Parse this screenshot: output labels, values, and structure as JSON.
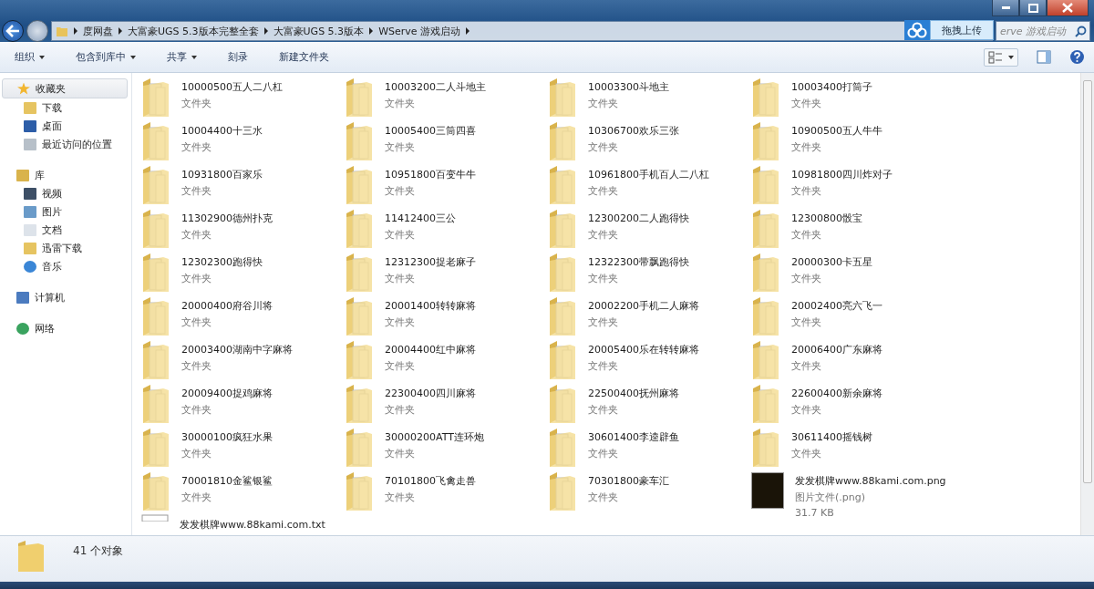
{
  "address_bar": {
    "crumbs": [
      "度网盘",
      "大富豪UGS 5.3版本完整全套",
      "大富豪UGS 5.3版本",
      "WServe 游戏启动"
    ]
  },
  "search": {
    "placeholder": "erve 游戏启动"
  },
  "upload_overlay": {
    "label": "拖拽上传"
  },
  "toolbar": [
    {
      "label": "组织",
      "menu": true
    },
    {
      "label": "包含到库中",
      "menu": true
    },
    {
      "label": "共享",
      "menu": true
    },
    {
      "label": "刻录",
      "menu": false
    },
    {
      "label": "新建文件夹",
      "menu": false
    }
  ],
  "sidebar": [
    {
      "label": "收藏夹",
      "kind": "favorites",
      "selected": true,
      "children": [
        {
          "label": "下载",
          "kind": "download"
        },
        {
          "label": "桌面",
          "kind": "desktop"
        },
        {
          "label": "最近访问的位置",
          "kind": "recent"
        }
      ]
    },
    {
      "label": "库",
      "kind": "library",
      "selected": false,
      "children": [
        {
          "label": "视频",
          "kind": "video"
        },
        {
          "label": "图片",
          "kind": "picture"
        },
        {
          "label": "文档",
          "kind": "document"
        },
        {
          "label": "迅雷下载",
          "kind": "download"
        },
        {
          "label": "音乐",
          "kind": "music"
        }
      ]
    },
    {
      "label": "计算机",
      "kind": "computer",
      "selected": false
    },
    {
      "label": "网络",
      "kind": "network",
      "selected": false
    }
  ],
  "files": [
    {
      "kind": "folder",
      "name": "10000500五人二八杠",
      "type": "文件夹"
    },
    {
      "kind": "folder",
      "name": "10003200二人斗地主",
      "type": "文件夹"
    },
    {
      "kind": "folder",
      "name": "10003300斗地主",
      "type": "文件夹"
    },
    {
      "kind": "folder",
      "name": "10003400打筒子",
      "type": "文件夹"
    },
    {
      "kind": "folder",
      "name": "10004400十三水",
      "type": "文件夹"
    },
    {
      "kind": "folder",
      "name": "10005400三筒四喜",
      "type": "文件夹"
    },
    {
      "kind": "folder",
      "name": "10306700欢乐三张",
      "type": "文件夹"
    },
    {
      "kind": "folder",
      "name": "10900500五人牛牛",
      "type": "文件夹"
    },
    {
      "kind": "folder",
      "name": "10931800百家乐",
      "type": "文件夹"
    },
    {
      "kind": "folder",
      "name": "10951800百变牛牛",
      "type": "文件夹"
    },
    {
      "kind": "folder",
      "name": "10961800手机百人二八杠",
      "type": "文件夹"
    },
    {
      "kind": "folder",
      "name": "10981800四川炸对子",
      "type": "文件夹"
    },
    {
      "kind": "folder",
      "name": "11302900德州扑克",
      "type": "文件夹"
    },
    {
      "kind": "folder",
      "name": "11412400三公",
      "type": "文件夹"
    },
    {
      "kind": "folder",
      "name": "12300200二人跑得快",
      "type": "文件夹"
    },
    {
      "kind": "folder",
      "name": "12300800骰宝",
      "type": "文件夹"
    },
    {
      "kind": "folder",
      "name": "12302300跑得快",
      "type": "文件夹"
    },
    {
      "kind": "folder",
      "name": "12312300捉老麻子",
      "type": "文件夹"
    },
    {
      "kind": "folder",
      "name": "12322300带飘跑得快",
      "type": "文件夹"
    },
    {
      "kind": "folder",
      "name": "20000300卡五星",
      "type": "文件夹"
    },
    {
      "kind": "folder",
      "name": "20000400府谷川将",
      "type": "文件夹"
    },
    {
      "kind": "folder",
      "name": "20001400转转麻将",
      "type": "文件夹"
    },
    {
      "kind": "folder",
      "name": "20002200手机二人麻将",
      "type": "文件夹"
    },
    {
      "kind": "folder",
      "name": "20002400亮六飞一",
      "type": "文件夹"
    },
    {
      "kind": "folder",
      "name": "20003400湖南中字麻将",
      "type": "文件夹"
    },
    {
      "kind": "folder",
      "name": "20004400红中麻将",
      "type": "文件夹"
    },
    {
      "kind": "folder",
      "name": "20005400乐在转转麻将",
      "type": "文件夹"
    },
    {
      "kind": "folder",
      "name": "20006400广东麻将",
      "type": "文件夹"
    },
    {
      "kind": "folder",
      "name": "20009400捉鸡麻将",
      "type": "文件夹"
    },
    {
      "kind": "folder",
      "name": "22300400四川麻将",
      "type": "文件夹"
    },
    {
      "kind": "folder",
      "name": "22500400抚州麻将",
      "type": "文件夹"
    },
    {
      "kind": "folder",
      "name": "22600400新余麻将",
      "type": "文件夹"
    },
    {
      "kind": "folder",
      "name": "30000100疯狂水果",
      "type": "文件夹"
    },
    {
      "kind": "folder",
      "name": "30000200ATT连环炮",
      "type": "文件夹"
    },
    {
      "kind": "folder",
      "name": "30601400李逵辟鱼",
      "type": "文件夹"
    },
    {
      "kind": "folder",
      "name": "30611400摇钱树",
      "type": "文件夹"
    },
    {
      "kind": "folder",
      "name": "70001810金鲨银鲨",
      "type": "文件夹"
    },
    {
      "kind": "folder",
      "name": "70101800飞禽走兽",
      "type": "文件夹"
    },
    {
      "kind": "folder",
      "name": "70301800豪车汇",
      "type": "文件夹"
    },
    {
      "kind": "image",
      "name": "发发棋牌www.88kami.com.png",
      "type": "图片文件(.png)",
      "size": "31.7 KB"
    },
    {
      "kind": "text",
      "name": "发发棋牌www.88kami.com.txt"
    }
  ],
  "status_bar": {
    "count": "41 个对象"
  }
}
